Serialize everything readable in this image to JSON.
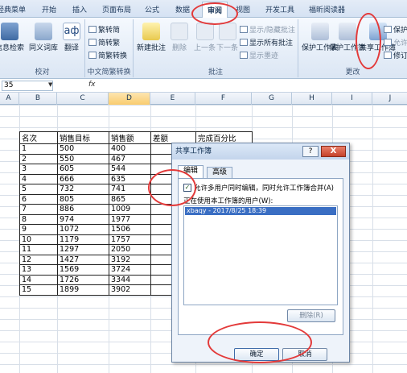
{
  "tabs": {
    "menu": "经典菜单",
    "start": "开始",
    "insert": "插入",
    "layout": "页面布局",
    "formula": "公式",
    "data": "数据",
    "review": "审阅",
    "view": "视图",
    "dev": "开发工具",
    "reader": "福昕阅读器"
  },
  "ribbon": {
    "proof": {
      "label": "校对",
      "research": "信息检索",
      "thesaurus": "同义词库",
      "translate": "翻译"
    },
    "chinese": {
      "label": "中文简繁转换",
      "to_simplified": "繁转简",
      "to_traditional": "简转繁",
      "convert": "简繁转换"
    },
    "comments": {
      "label": "批注",
      "new": "新建批注",
      "delete": "删除",
      "prev": "上一条",
      "next": "下一条",
      "show_hide": "显示/隐藏批注",
      "show_all": "显示所有批注",
      "show_ink": "显示墨迹"
    },
    "changes": {
      "label": "更改",
      "protect_sheet": "保护工作表",
      "protect_workbook": "保护工作簿",
      "share_workbook": "共享工作簿",
      "protect_share": "保护",
      "allow_edit": "允许",
      "track": "修订"
    }
  },
  "formula_bar": {
    "name_box": "35",
    "fx": "fx"
  },
  "columns": [
    "A",
    "B",
    "C",
    "D",
    "E",
    "F",
    "G",
    "H",
    "I",
    "J"
  ],
  "table": {
    "headers": [
      "名次",
      "销售目标",
      "销售额",
      "差额",
      "完成百分比"
    ],
    "rows": [
      [
        "1",
        "500",
        "400"
      ],
      [
        "2",
        "550",
        "467"
      ],
      [
        "3",
        "605",
        "544"
      ],
      [
        "4",
        "666",
        "635"
      ],
      [
        "5",
        "732",
        "741"
      ],
      [
        "6",
        "805",
        "865"
      ],
      [
        "7",
        "886",
        "1009"
      ],
      [
        "8",
        "974",
        "1977"
      ],
      [
        "9",
        "1072",
        "1506"
      ],
      [
        "10",
        "1179",
        "1757"
      ],
      [
        "11",
        "1297",
        "2050"
      ],
      [
        "12",
        "1427",
        "3192"
      ],
      [
        "13",
        "1569",
        "3724"
      ],
      [
        "14",
        "1726",
        "3344"
      ],
      [
        "15",
        "1899",
        "3902"
      ]
    ]
  },
  "dialog": {
    "title": "共享工作簿",
    "help": "?",
    "close": "X",
    "tab_edit": "编辑",
    "tab_advanced": "高级",
    "allow_checkbox_label": "允许多用户同时编辑，同时允许工作簿合并(A)",
    "allow_checked": true,
    "users_label": "正在使用本工作簿的用户(W):",
    "users": [
      "xbaqy - 2017/8/25 18:39"
    ],
    "remove_button": "删除(R)",
    "ok_button": "确定",
    "cancel_button": "取消"
  },
  "colors": {
    "annotation": "#e33a3a",
    "selection": "#3a6ec3"
  }
}
